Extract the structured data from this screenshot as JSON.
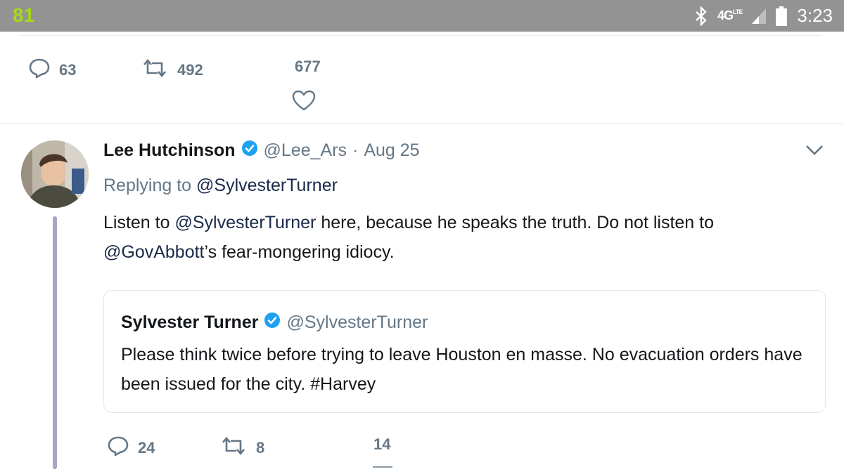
{
  "status_bar": {
    "left_number": "81",
    "network": "4G",
    "network_sub": "LTE",
    "time": "3:23",
    "icons": [
      "bluetooth-icon",
      "signal-icon",
      "battery-icon"
    ]
  },
  "previous_tweet_actions": {
    "replies": "63",
    "retweets": "492",
    "likes": "677"
  },
  "tweet": {
    "author_name": "Lee Hutchinson",
    "handle": "@Lee_Ars",
    "separator": "·",
    "date": "Aug 25",
    "replying_prefix": "Replying to",
    "replying_to": "@SylvesterTurner",
    "text_line1_mention": "@SylvesterTurner",
    "text_line1_prefix": "Listen to",
    "text_line1_suffix": "here, because he speaks the truth. Do not listen to",
    "text_line2_mention": "@GovAbbott",
    "text_line2_suffix": "’s fear-mongering idiocy.",
    "quote": {
      "author_name": "Sylvester Turner",
      "handle": "@SylvesterTurner",
      "text": "Please think twice before trying to leave Houston en masse. No evacuation orders have been issued for the city. #Harvey"
    },
    "actions": {
      "replies": "24",
      "retweets": "8",
      "likes": "14"
    }
  },
  "colors": {
    "status_bar": "#939393",
    "muted": "#657786",
    "verified": "#1da1f2",
    "thread_line": "#a6a6c4"
  }
}
